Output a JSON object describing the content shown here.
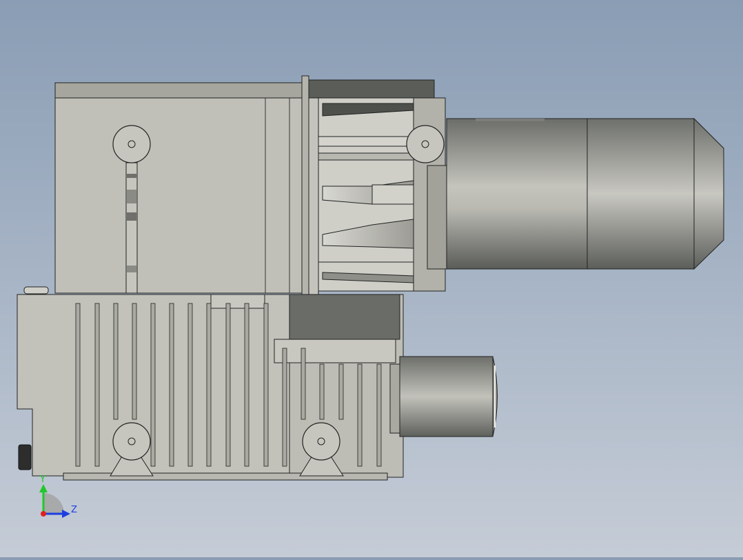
{
  "viewport": {
    "view_orientation": "side",
    "background_top": "#8a9db4",
    "background_bottom": "#c5ccd6"
  },
  "model": {
    "name": "",
    "body_color": "#c0c0b8",
    "body_shade": "#a8a8a0",
    "dark_metal": "#5e605c",
    "motor_color": "#8f908a",
    "motor_highlight": "#c9c9c2"
  },
  "triad": {
    "y_label": "Y",
    "z_label": "Z",
    "y_color": "#21c82a",
    "z_color": "#1d3ee0",
    "x_color": "#e02020",
    "sphere_color": "#9a9a9a"
  }
}
